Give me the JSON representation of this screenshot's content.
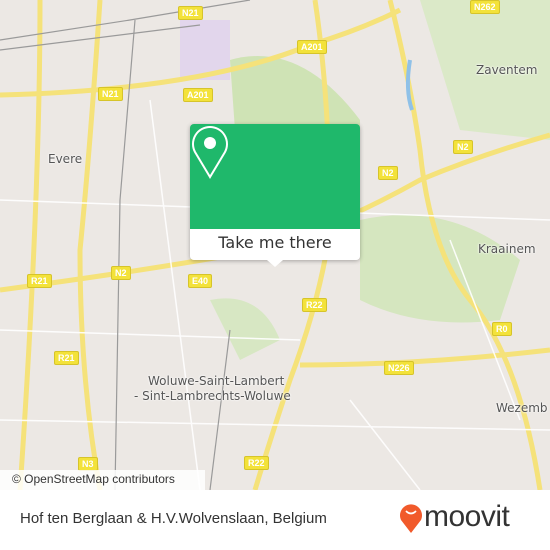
{
  "map": {
    "places": [
      {
        "name": "Zaventem"
      },
      {
        "name": "Evere"
      },
      {
        "name": "Kraainem"
      },
      {
        "name": "Woluwe-Saint-Lambert"
      },
      {
        "name": "- Sint-Lambrechts-Woluwe"
      },
      {
        "name": "Wezemb"
      }
    ],
    "road_shields": [
      "N21",
      "N262",
      "A201",
      "N21",
      "A201",
      "N2",
      "N2",
      "R21",
      "N2",
      "E40",
      "R22",
      "R0",
      "N226",
      "R21",
      "N3",
      "R22"
    ],
    "attribution": "© OpenStreetMap contributors"
  },
  "popup": {
    "icon": "map-pin-icon",
    "button_label": "Take me there",
    "color": "#1fb86b"
  },
  "footer": {
    "address": "Hof ten Berglaan & H.V.Wolvenslaan, Belgium",
    "brand": "moovit",
    "brand_color": "#f15a2b"
  }
}
